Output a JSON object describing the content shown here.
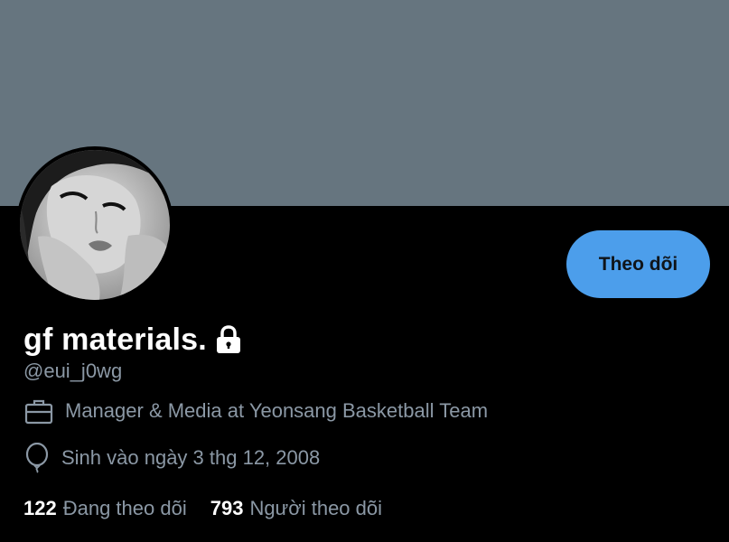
{
  "profile": {
    "banner_color": "#66757f",
    "avatar_icon": "profile-photo",
    "display_name": "gf materials.",
    "protected_icon": "lock-icon",
    "handle": "@eui_j0wg",
    "work_icon": "briefcase-icon",
    "work": "Manager & Media at Yeonsang Basketball Team",
    "birth_icon": "balloon-icon",
    "birthday": "Sinh vào ngày 3 thg 12, 2008"
  },
  "actions": {
    "follow_label": "Theo dõi",
    "follow_color": "#4c9eeb"
  },
  "stats": {
    "following_count": "122",
    "following_label": "Đang theo dõi",
    "followers_count": "793",
    "followers_label": "Người theo dõi"
  }
}
